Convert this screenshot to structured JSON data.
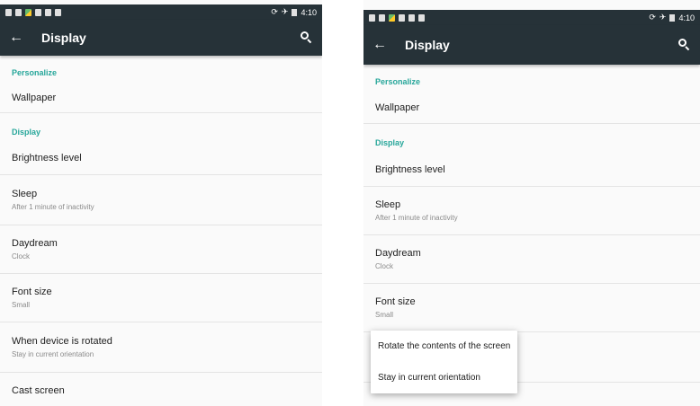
{
  "left_screen": {
    "status_bar": {
      "time": "4:10"
    },
    "app_bar": {
      "title": "Display"
    },
    "sections": [
      {
        "header": "Personalize",
        "items": [
          {
            "title": "Wallpaper",
            "summary": ""
          }
        ]
      },
      {
        "header": "Display",
        "items": [
          {
            "title": "Brightness level",
            "summary": ""
          },
          {
            "title": "Sleep",
            "summary": "After 1 minute of inactivity"
          },
          {
            "title": "Daydream",
            "summary": "Clock"
          },
          {
            "title": "Font size",
            "summary": "Small"
          },
          {
            "title": "When device is rotated",
            "summary": "Stay in current orientation"
          },
          {
            "title": "Cast screen",
            "summary": ""
          }
        ]
      }
    ]
  },
  "right_screen": {
    "status_bar": {
      "time": "4:10"
    },
    "app_bar": {
      "title": "Display"
    },
    "sections": [
      {
        "header": "Personalize",
        "items": [
          {
            "title": "Wallpaper",
            "summary": ""
          }
        ]
      },
      {
        "header": "Display",
        "items": [
          {
            "title": "Brightness level",
            "summary": ""
          },
          {
            "title": "Sleep",
            "summary": "After 1 minute of inactivity"
          },
          {
            "title": "Daydream",
            "summary": "Clock"
          },
          {
            "title": "Font size",
            "summary": "Small"
          }
        ]
      }
    ],
    "rotation_menu": {
      "options": [
        "Rotate the contents of the screen",
        "Stay in current orientation"
      ]
    }
  },
  "colors": {
    "app_bar": "#263238",
    "accent": "#26a69a",
    "background": "#fafafa"
  },
  "icons": [
    "back-arrow-icon",
    "search-icon"
  ]
}
